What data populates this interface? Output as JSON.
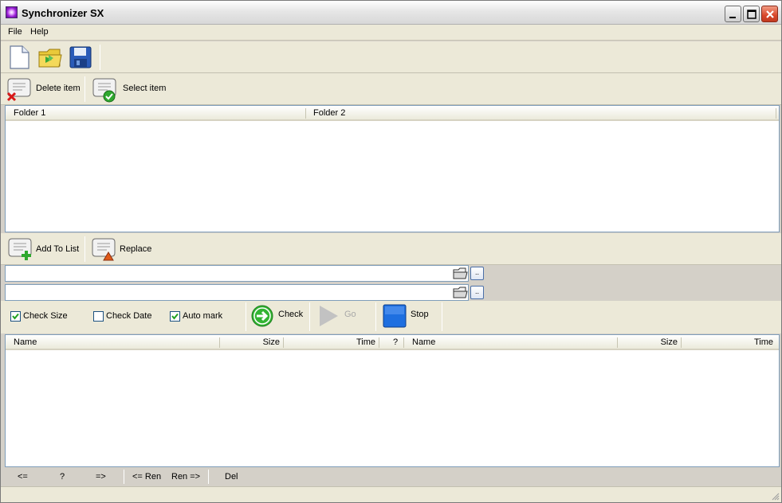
{
  "window": {
    "title": "Synchronizer SX"
  },
  "menu": {
    "file": "File",
    "help": "Help"
  },
  "toolbar_top": {
    "icons": [
      "new-file-icon",
      "open-folder-icon",
      "save-icon"
    ]
  },
  "item_toolbar": {
    "delete_label": "Delete item",
    "select_label": "Select item"
  },
  "folder_list": {
    "columns": [
      "Folder 1",
      "Folder 2"
    ]
  },
  "list_toolbar": {
    "add_label": "Add To List",
    "replace_label": "Replace"
  },
  "paths": {
    "folder1": {
      "value": "",
      "browse": ".."
    },
    "folder2": {
      "value": "",
      "browse": ".."
    }
  },
  "options": {
    "check_size": {
      "label": "Check Size",
      "checked": true
    },
    "check_date": {
      "label": "Check Date",
      "checked": false
    },
    "auto_mark": {
      "label": "Auto mark",
      "checked": true
    }
  },
  "actions": {
    "check": "Check",
    "go": "Go",
    "stop": "Stop"
  },
  "compare_list": {
    "columns": [
      "Name",
      "Size",
      "Time",
      "?",
      "Name",
      "Size",
      "Time"
    ]
  },
  "bottom_actions": {
    "left": "<=",
    "unknown": "?",
    "right": "=>",
    "ren_left": "<= Ren",
    "ren_right": "Ren =>",
    "del": "Del"
  },
  "colors": {
    "accent_green": "#2fa82f",
    "stop_blue": "#1e6fe0",
    "list_border": "#7f9db9"
  }
}
